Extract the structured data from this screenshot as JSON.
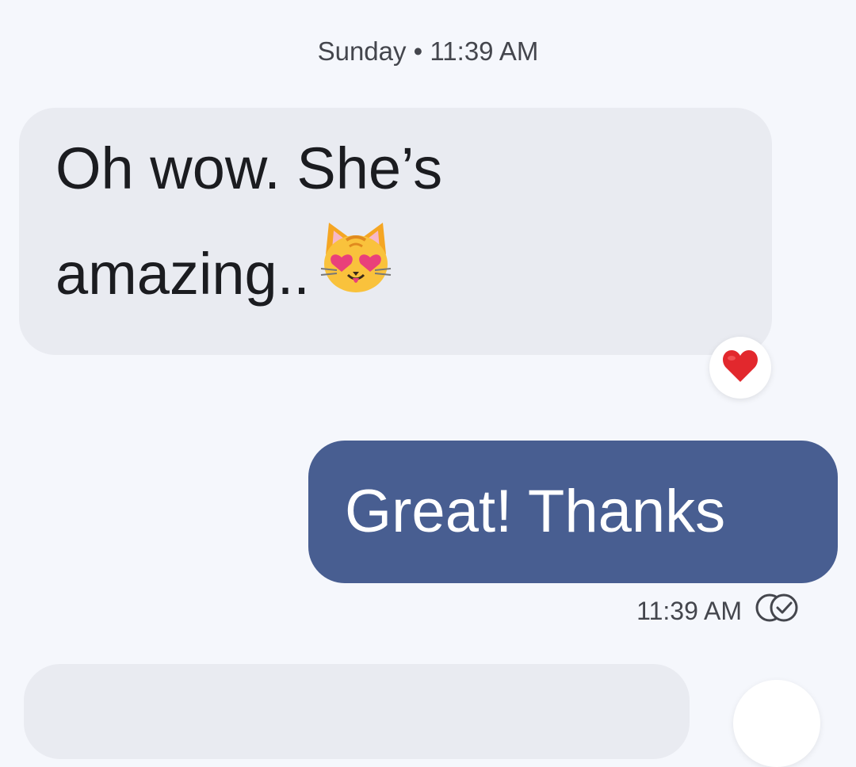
{
  "conversation": {
    "date_header": "Sunday • 11:39 AM",
    "messages": [
      {
        "direction": "incoming",
        "text": "Oh wow. She’s amazing..",
        "emoji": "smiling-cat-with-heart-eyes",
        "reaction": "red-heart"
      },
      {
        "direction": "outgoing",
        "text": "Great! Thanks",
        "timestamp": "11:39 AM",
        "status_icon": "read-double-check-icon"
      }
    ]
  },
  "colors": {
    "background": "#f5f7fc",
    "incoming_bubble": "#e9ebf1",
    "outgoing_bubble": "#485e91",
    "outgoing_text": "#ffffff",
    "reaction_heart": "#e2282d"
  }
}
